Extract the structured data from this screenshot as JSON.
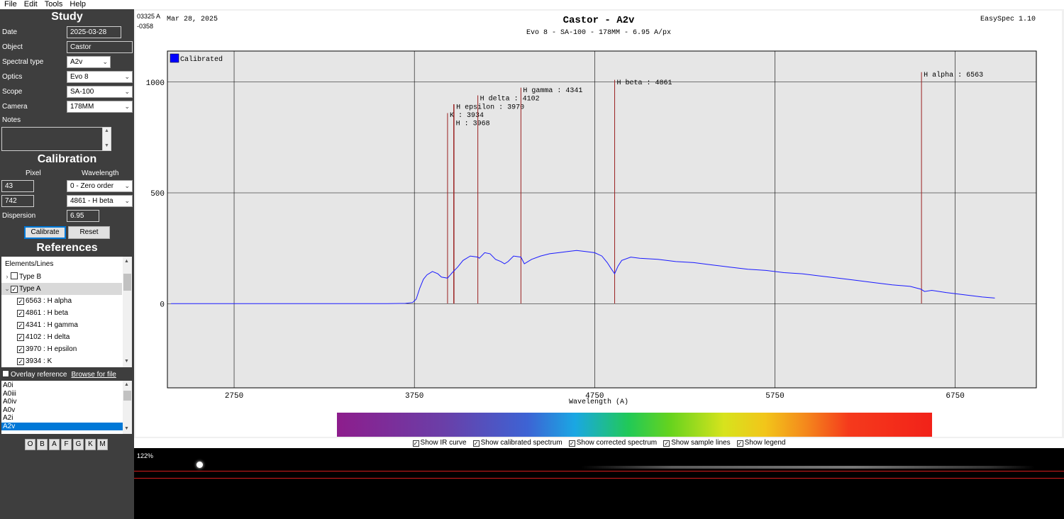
{
  "menu": [
    "File",
    "Edit",
    "Tools",
    "Help"
  ],
  "study": {
    "title": "Study",
    "date_label": "Date",
    "date_value": "2025-03-28",
    "object_label": "Object",
    "object_value": "Castor",
    "spectral_type_label": "Spectral type",
    "spectral_type_value": "A2v",
    "optics_label": "Optics",
    "optics_value": "Evo 8",
    "scope_label": "Scope",
    "scope_value": "SA-100",
    "camera_label": "Camera",
    "camera_value": "178MM",
    "notes_label": "Notes"
  },
  "calibration": {
    "title": "Calibration",
    "pixel_header": "Pixel",
    "wavelength_header": "Wavelength",
    "pixel1": "43",
    "wavelength1": "0 - Zero order",
    "pixel2": "742",
    "wavelength2": "4861 - H beta",
    "dispersion_label": "Dispersion",
    "dispersion_value": "6.95",
    "calibrate_label": "Calibrate",
    "reset_label": "Reset"
  },
  "references": {
    "title": "References",
    "tree_header": "Elements/Lines",
    "items": [
      {
        "label": "Type B",
        "checked": false,
        "expander": "›"
      },
      {
        "label": "Type A",
        "checked": true,
        "expander": "⌄"
      },
      {
        "label": "6563 : H alpha",
        "checked": true
      },
      {
        "label": "4861 : H beta",
        "checked": true
      },
      {
        "label": "4341 : H gamma",
        "checked": true
      },
      {
        "label": "4102 : H delta",
        "checked": true
      },
      {
        "label": "3970 : H epsilon",
        "checked": true
      },
      {
        "label": "3934 : K",
        "checked": true
      }
    ],
    "overlay_label": "Overlay reference",
    "browse_label": "Browse for file",
    "type_list": [
      "A0i",
      "A0iii",
      "A0iv",
      "A0v",
      "A2i",
      "A2v"
    ],
    "selected_type": "A2v",
    "class_buttons": [
      "O",
      "B",
      "A",
      "F",
      "G",
      "K",
      "M"
    ]
  },
  "chart": {
    "corner_left_1": "03325 A",
    "corner_left_2": "-0358",
    "date_text": "Mar 28, 2025",
    "app_version": "EasySpec 1.10"
  },
  "chart_data": {
    "type": "line",
    "title": "Castor - A2v",
    "subtitle": "Evo 8 - SA-100 - 178MM - 6.95 A/px",
    "xlabel": "Wavelength (A)",
    "ylabel": "",
    "xlim": [
      2380,
      7200
    ],
    "ylim": [
      -380,
      1140
    ],
    "x_ticks": [
      2750,
      3750,
      4750,
      5750,
      6750
    ],
    "y_ticks": [
      0,
      500,
      1000
    ],
    "grid": true,
    "legend": {
      "placement": "top-left",
      "entries": [
        "Calibrated"
      ]
    },
    "series": [
      {
        "name": "Calibrated",
        "color": "#1a1aff",
        "points": [
          [
            2400,
            0
          ],
          [
            3000,
            0
          ],
          [
            3600,
            0
          ],
          [
            3700,
            1
          ],
          [
            3740,
            5
          ],
          [
            3760,
            20
          ],
          [
            3780,
            70
          ],
          [
            3800,
            110
          ],
          [
            3820,
            130
          ],
          [
            3850,
            145
          ],
          [
            3880,
            135
          ],
          [
            3900,
            120
          ],
          [
            3934,
            115
          ],
          [
            3960,
            140
          ],
          [
            3990,
            165
          ],
          [
            4020,
            195
          ],
          [
            4060,
            215
          ],
          [
            4102,
            210
          ],
          [
            4110,
            205
          ],
          [
            4140,
            230
          ],
          [
            4170,
            225
          ],
          [
            4200,
            200
          ],
          [
            4230,
            190
          ],
          [
            4250,
            180
          ],
          [
            4270,
            190
          ],
          [
            4300,
            215
          ],
          [
            4341,
            210
          ],
          [
            4360,
            180
          ],
          [
            4400,
            200
          ],
          [
            4450,
            215
          ],
          [
            4500,
            225
          ],
          [
            4550,
            230
          ],
          [
            4600,
            235
          ],
          [
            4650,
            240
          ],
          [
            4700,
            235
          ],
          [
            4750,
            230
          ],
          [
            4790,
            215
          ],
          [
            4820,
            185
          ],
          [
            4840,
            160
          ],
          [
            4861,
            135
          ],
          [
            4880,
            170
          ],
          [
            4900,
            195
          ],
          [
            4950,
            210
          ],
          [
            5000,
            205
          ],
          [
            5100,
            200
          ],
          [
            5200,
            190
          ],
          [
            5300,
            185
          ],
          [
            5400,
            175
          ],
          [
            5500,
            165
          ],
          [
            5600,
            155
          ],
          [
            5700,
            150
          ],
          [
            5800,
            140
          ],
          [
            5900,
            135
          ],
          [
            6000,
            125
          ],
          [
            6100,
            115
          ],
          [
            6200,
            105
          ],
          [
            6300,
            95
          ],
          [
            6400,
            85
          ],
          [
            6500,
            78
          ],
          [
            6560,
            65
          ],
          [
            6580,
            55
          ],
          [
            6620,
            60
          ],
          [
            6700,
            50
          ],
          [
            6800,
            40
          ],
          [
            6900,
            30
          ],
          [
            6970,
            25
          ]
        ]
      }
    ],
    "reference_lines": [
      {
        "wavelength": 3934,
        "label": "K : 3934",
        "top": 860,
        "label_y": 842
      },
      {
        "wavelength": 3968,
        "label": "H : 3968",
        "top": 900,
        "label_y": 806
      },
      {
        "wavelength": 3970,
        "label": "H epsilon : 3970",
        "top": 900,
        "label_y": 880
      },
      {
        "wavelength": 4102,
        "label": "H delta : 4102",
        "top": 940,
        "label_y": 918
      },
      {
        "wavelength": 4341,
        "label": "H gamma : 4341",
        "top": 975,
        "label_y": 955
      },
      {
        "wavelength": 4861,
        "label": "H beta : 4861",
        "top": 1010,
        "label_y": 990
      },
      {
        "wavelength": 6563,
        "label": "H alpha : 6563",
        "top": 1045,
        "label_y": 1025
      }
    ]
  },
  "options": [
    {
      "label": "Show IR curve",
      "checked": true
    },
    {
      "label": "Show calibrated spectrum",
      "checked": true
    },
    {
      "label": "Show corrected spectrum",
      "checked": true
    },
    {
      "label": "Show sample lines",
      "checked": true
    },
    {
      "label": "Show legend",
      "checked": true
    }
  ],
  "raw_view": {
    "zoom": "122%"
  }
}
